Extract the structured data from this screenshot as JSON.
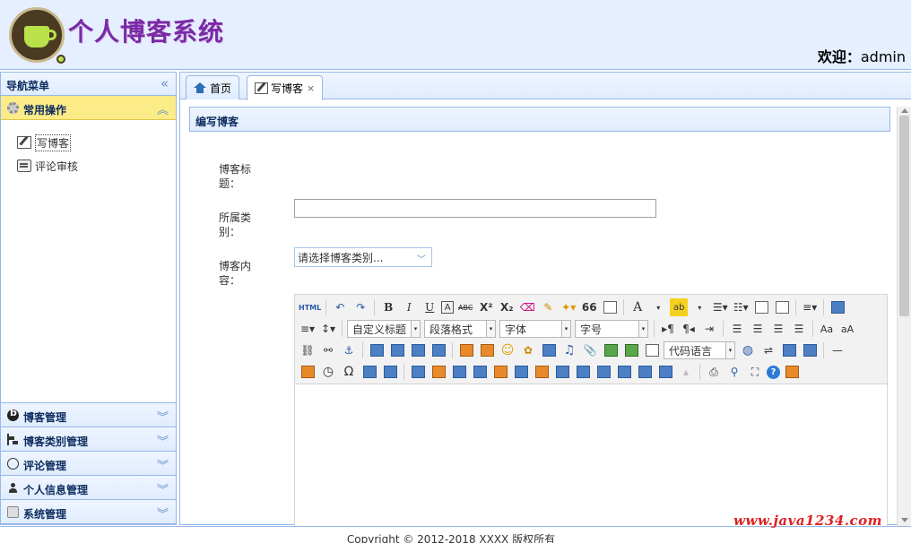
{
  "header": {
    "site_title": "个人博客系统",
    "welcome_label": "欢迎：",
    "username": "admin"
  },
  "sidebar": {
    "title": "导航菜单",
    "collapse_glyph": "«",
    "panels": [
      {
        "label": "常用操作",
        "chevron": "︽",
        "items": [
          {
            "label": "写博客"
          },
          {
            "label": "评论审核"
          }
        ]
      },
      {
        "label": "博客管理",
        "chevron": "︾"
      },
      {
        "label": "博客类别管理",
        "chevron": "︾"
      },
      {
        "label": "评论管理",
        "chevron": "︾"
      },
      {
        "label": "个人信息管理",
        "chevron": "︾"
      },
      {
        "label": "系统管理",
        "chevron": "︾"
      }
    ]
  },
  "tabs": [
    {
      "label": "首页"
    },
    {
      "label": "写博客",
      "close": "×"
    }
  ],
  "form": {
    "panel_title": "编写博客",
    "title_label": "博客标题：",
    "title_value": "",
    "category_label": "所属类别：",
    "category_value": "请选择博客类别...",
    "content_label": "博客内容："
  },
  "editor": {
    "html_btn": "HTML",
    "bold": "B",
    "italic": "I",
    "underline": "U",
    "strike": "ABC",
    "font_color": "A",
    "highlight": "ab",
    "custom_title": "自定义标题",
    "paragraph": "段落格式",
    "font_family": "字体",
    "font_size": "字号",
    "code_lang": "代码语言",
    "omega": "Ω",
    "quote": "66",
    "hr": "—"
  },
  "footer": {
    "copyright": "Copyright © 2012-2018 XXXX 版权所有"
  },
  "watermark": "www.java1234.com",
  "colors": {
    "header_bg": "#e5efff",
    "border": "#95b8e7",
    "active_panel": "#fbec88",
    "title_purple": "#7a2aa6",
    "watermark_red": "#e02020"
  }
}
